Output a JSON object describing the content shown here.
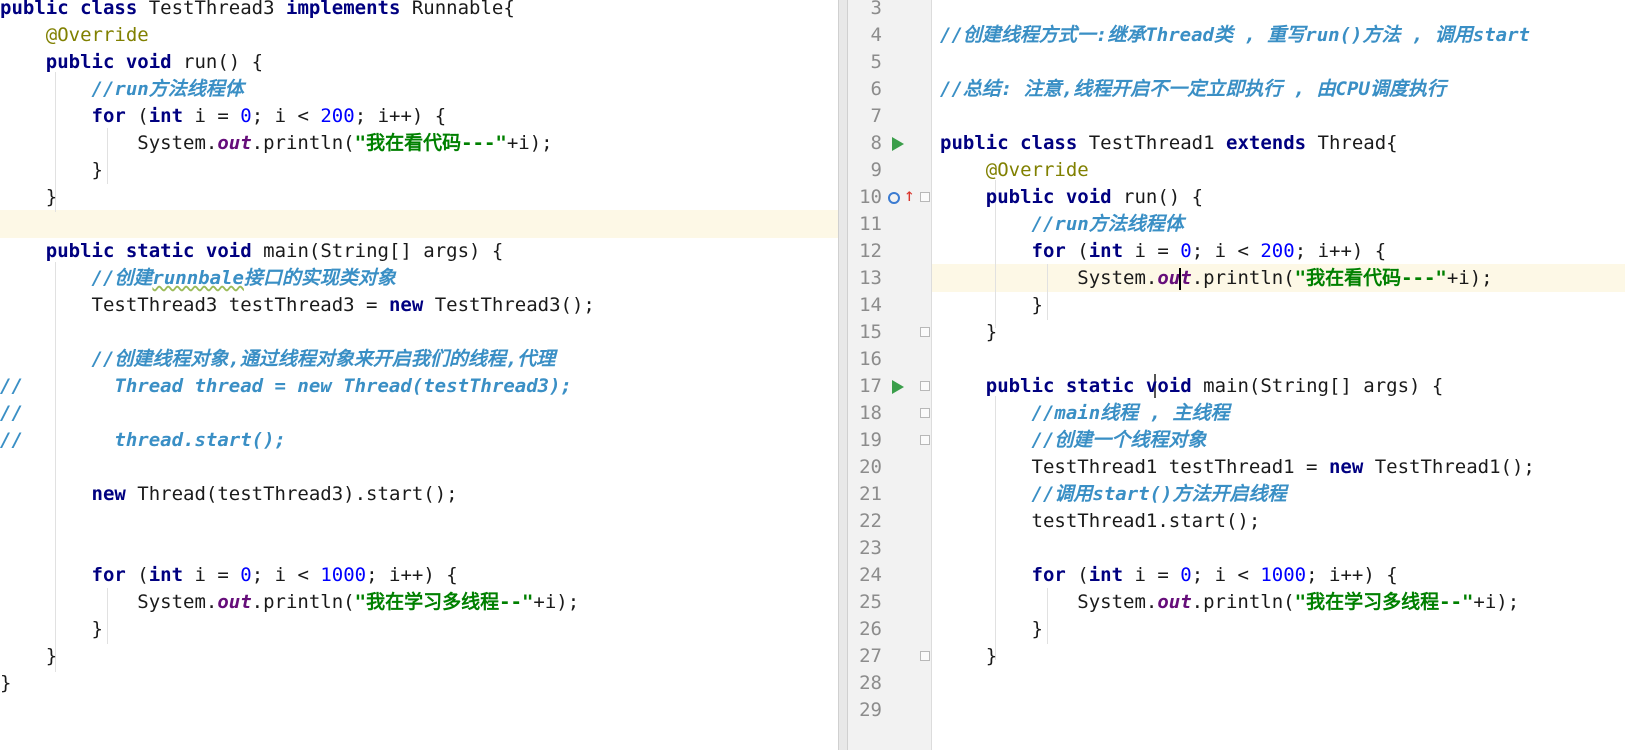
{
  "left_editor": {
    "lines": [
      [
        [
          "k",
          "public "
        ],
        [
          "k",
          "class "
        ],
        [
          "pl",
          "TestThread3 "
        ],
        [
          "k",
          "implements "
        ],
        [
          "pl",
          "Runnable{"
        ]
      ],
      [
        [
          "pl",
          "    "
        ],
        [
          "ann",
          "@Override"
        ]
      ],
      [
        [
          "pl",
          "    "
        ],
        [
          "k",
          "public "
        ],
        [
          "k",
          "void "
        ],
        [
          "pl",
          "run() {"
        ]
      ],
      [
        [
          "pl",
          "        "
        ],
        [
          "cm",
          "//run方法线程体"
        ]
      ],
      [
        [
          "pl",
          "        "
        ],
        [
          "k",
          "for "
        ],
        [
          "pl",
          "("
        ],
        [
          "k",
          "int "
        ],
        [
          "pl",
          "i = "
        ],
        [
          "num",
          "0"
        ],
        [
          "pl",
          "; i < "
        ],
        [
          "num",
          "200"
        ],
        [
          "pl",
          "; i++) {"
        ]
      ],
      [
        [
          "pl",
          "            System."
        ],
        [
          "ital",
          "out"
        ],
        [
          "pl",
          ".println("
        ],
        [
          "str",
          "\"我在看代码---\""
        ],
        [
          "pl",
          "+i);"
        ]
      ],
      [
        [
          "pl",
          "        }"
        ]
      ],
      [
        [
          "pl",
          "    }"
        ]
      ],
      [
        [
          "pl",
          ""
        ]
      ],
      [
        [
          "pl",
          "    "
        ],
        [
          "k",
          "public "
        ],
        [
          "k",
          "static "
        ],
        [
          "k",
          "void "
        ],
        [
          "pl",
          "main(String[] args) {"
        ]
      ],
      [
        [
          "pl",
          "        "
        ],
        [
          "cm",
          "//创建"
        ],
        [
          "cm-sq",
          "runnbale"
        ],
        [
          "cm",
          "接口的实现类对象"
        ]
      ],
      [
        [
          "pl",
          "        TestThread3 testThread3 = "
        ],
        [
          "k",
          "new "
        ],
        [
          "pl",
          "TestThread3();"
        ]
      ],
      [
        [
          "pl",
          ""
        ]
      ],
      [
        [
          "pl",
          "        "
        ],
        [
          "cm",
          "//创建线程对象,通过线程对象来开启我们的线程,代理"
        ]
      ],
      [
        [
          "cm",
          "//        Thread thread = new Thread(testThread3);"
        ]
      ],
      [
        [
          "cm",
          "//"
        ]
      ],
      [
        [
          "cm",
          "//        thread.start();"
        ]
      ],
      [
        [
          "pl",
          ""
        ]
      ],
      [
        [
          "pl",
          "        "
        ],
        [
          "k",
          "new "
        ],
        [
          "pl",
          "Thread(testThread3).start();"
        ]
      ],
      [
        [
          "pl",
          ""
        ]
      ],
      [
        [
          "pl",
          ""
        ]
      ],
      [
        [
          "pl",
          "        "
        ],
        [
          "k",
          "for "
        ],
        [
          "pl",
          "("
        ],
        [
          "k",
          "int "
        ],
        [
          "pl",
          "i = "
        ],
        [
          "num",
          "0"
        ],
        [
          "pl",
          "; i < "
        ],
        [
          "num",
          "1000"
        ],
        [
          "pl",
          "; i++) {"
        ]
      ],
      [
        [
          "pl",
          "            System."
        ],
        [
          "ital",
          "out"
        ],
        [
          "pl",
          ".println("
        ],
        [
          "str",
          "\"我在学习多线程--\""
        ],
        [
          "pl",
          "+i);"
        ]
      ],
      [
        [
          "pl",
          "        }"
        ]
      ],
      [
        [
          "pl",
          "    }"
        ]
      ],
      [
        [
          "pl",
          "}"
        ]
      ]
    ]
  },
  "right_editor": {
    "line_numbers": [
      "3",
      "4",
      "5",
      "6",
      "7",
      "8",
      "9",
      "10",
      "11",
      "12",
      "13",
      "14",
      "15",
      "16",
      "17",
      "18",
      "19",
      "20",
      "21",
      "22",
      "23",
      "24",
      "25",
      "26",
      "27",
      "28",
      "29"
    ],
    "lines": [
      [
        [
          "pl",
          ""
        ]
      ],
      [
        [
          "cm",
          "//创建线程方式一:继承Thread类 , 重写run()方法 , 调用start"
        ]
      ],
      [
        [
          "pl",
          ""
        ]
      ],
      [
        [
          "cm",
          "//总结: 注意,线程开启不一定立即执行 , 由CPU调度执行"
        ]
      ],
      [
        [
          "pl",
          ""
        ]
      ],
      [
        [
          "k",
          "public "
        ],
        [
          "k",
          "class "
        ],
        [
          "pl",
          "TestThread1 "
        ],
        [
          "k",
          "extends "
        ],
        [
          "pl",
          "Thread{"
        ]
      ],
      [
        [
          "pl",
          "    "
        ],
        [
          "ann",
          "@Override"
        ]
      ],
      [
        [
          "pl",
          "    "
        ],
        [
          "k",
          "public "
        ],
        [
          "k",
          "void "
        ],
        [
          "pl",
          "run() {"
        ]
      ],
      [
        [
          "pl",
          "        "
        ],
        [
          "cm",
          "//run方法线程体"
        ]
      ],
      [
        [
          "pl",
          "        "
        ],
        [
          "k",
          "for "
        ],
        [
          "pl",
          "("
        ],
        [
          "k",
          "int "
        ],
        [
          "pl",
          "i = "
        ],
        [
          "num",
          "0"
        ],
        [
          "pl",
          "; i < "
        ],
        [
          "num",
          "200"
        ],
        [
          "pl",
          "; i++) {"
        ]
      ],
      [
        [
          "pl",
          "            System."
        ],
        [
          "ital",
          "ou"
        ],
        [
          "caret",
          ""
        ],
        [
          "ital",
          "t"
        ],
        [
          "pl",
          ".println("
        ],
        [
          "str",
          "\"我在看代码---\""
        ],
        [
          "pl",
          "+i);"
        ]
      ],
      [
        [
          "pl",
          "        }"
        ]
      ],
      [
        [
          "pl",
          "    }"
        ]
      ],
      [
        [
          "pl",
          ""
        ]
      ],
      [
        [
          "pl",
          "    "
        ],
        [
          "k",
          "public "
        ],
        [
          "k",
          "static "
        ],
        [
          "k",
          "void "
        ],
        [
          "pl",
          "main(String[] args) {"
        ]
      ],
      [
        [
          "pl",
          "        "
        ],
        [
          "cm",
          "//main线程 , 主线程"
        ]
      ],
      [
        [
          "pl",
          "        "
        ],
        [
          "cm",
          "//创建一个线程对象"
        ]
      ],
      [
        [
          "pl",
          "        TestThread1 testThread1 = "
        ],
        [
          "k",
          "new "
        ],
        [
          "pl",
          "TestThread1();"
        ]
      ],
      [
        [
          "pl",
          "        "
        ],
        [
          "cm",
          "//调用start()方法开启线程"
        ]
      ],
      [
        [
          "pl",
          "        testThread1.start();"
        ]
      ],
      [
        [
          "pl",
          ""
        ]
      ],
      [
        [
          "pl",
          "        "
        ],
        [
          "k",
          "for "
        ],
        [
          "pl",
          "("
        ],
        [
          "k",
          "int "
        ],
        [
          "pl",
          "i = "
        ],
        [
          "num",
          "0"
        ],
        [
          "pl",
          "; i < "
        ],
        [
          "num",
          "1000"
        ],
        [
          "pl",
          "; i++) {"
        ]
      ],
      [
        [
          "pl",
          "            System."
        ],
        [
          "ital",
          "out"
        ],
        [
          "pl",
          ".println("
        ],
        [
          "str",
          "\"我在学习多线程--\""
        ],
        [
          "pl",
          "+i);"
        ]
      ],
      [
        [
          "pl",
          "        }"
        ]
      ],
      [
        [
          "pl",
          "    }"
        ]
      ],
      [
        [
          "pl",
          ""
        ]
      ],
      [
        [
          "pl",
          ""
        ]
      ]
    ]
  },
  "colors": {
    "keyword": "#000080",
    "annotation": "#808000",
    "number": "#0000ff",
    "string": "#008000",
    "comment": "#3a8fc5",
    "static_field": "#660e7a",
    "current_line": "#fdf8e6",
    "run_icon": "#3a9e4a"
  },
  "icons": {
    "run": "run-gutter-icon",
    "override": "override-method-icon",
    "fold": "fold-marker-icon"
  }
}
